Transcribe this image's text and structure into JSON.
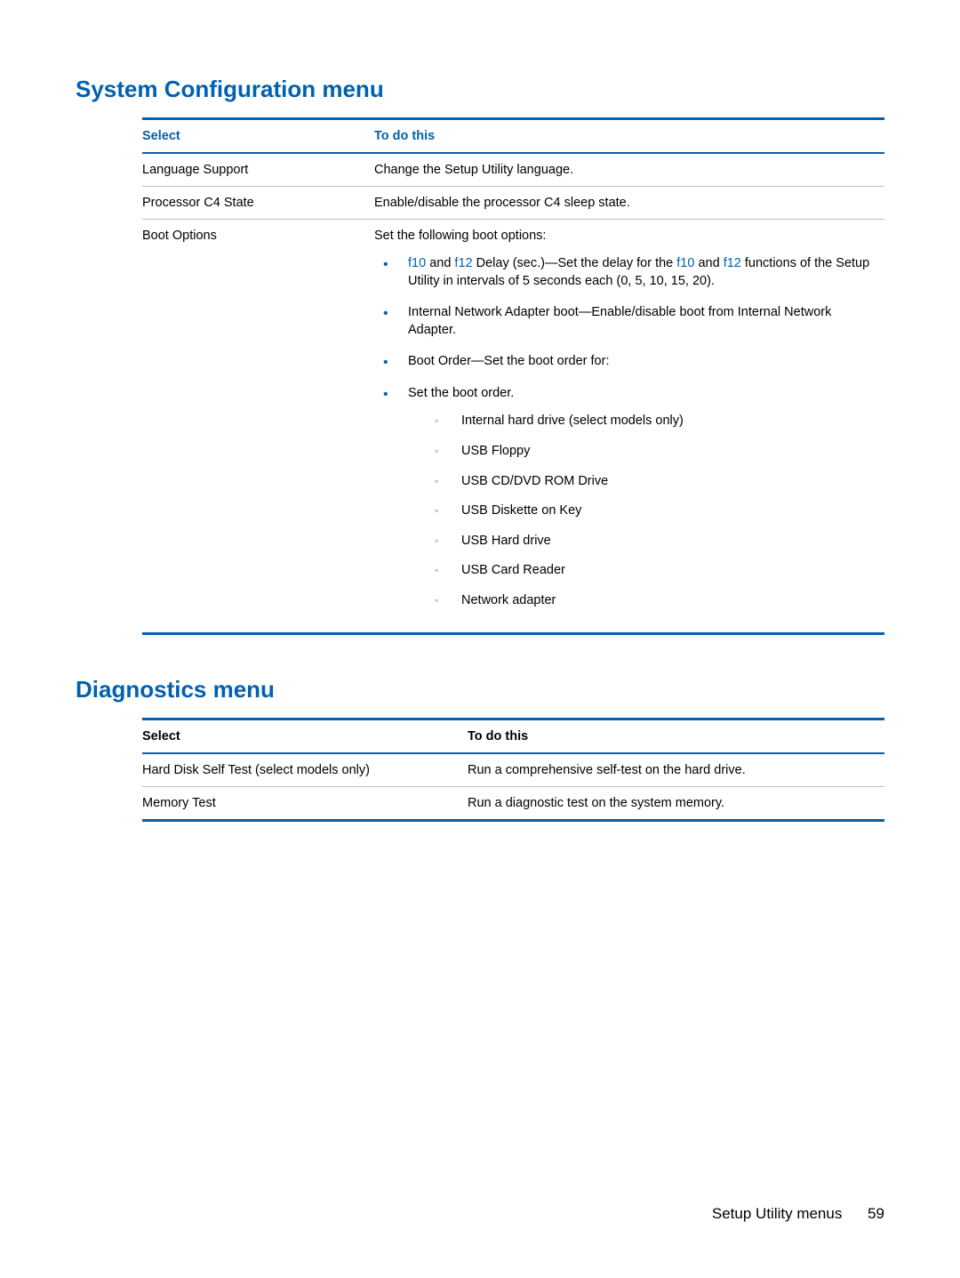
{
  "section1": {
    "title": "System Configuration menu",
    "headers": {
      "col1": "Select",
      "col2": "To do this"
    },
    "rows": [
      {
        "select": "Language Support",
        "desc": "Change the Setup Utility language."
      },
      {
        "select": "Processor C4 State",
        "desc": "Enable/disable the processor C4 sleep state."
      }
    ],
    "bootOptions": {
      "select": "Boot Options",
      "intro": "Set the following boot options:",
      "bullets": {
        "b1_pre": "",
        "b1_f10": "f10",
        "b1_mid1": " and ",
        "b1_f12": "f12",
        "b1_mid2": " Delay (sec.)—Set the delay for the ",
        "b1_f10b": "f10",
        "b1_mid3": " and ",
        "b1_f12b": "f12",
        "b1_post": " functions of the Setup Utility in intervals of 5 seconds each (0, 5, 10, 15, 20).",
        "b2": "Internal Network Adapter boot—Enable/disable boot from Internal Network Adapter.",
        "b3": "Boot Order—Set the boot order for:",
        "b4": "Set the boot order."
      },
      "sub": [
        "Internal hard drive (select models only)",
        "USB Floppy",
        "USB CD/DVD ROM Drive",
        "USB Diskette on Key",
        "USB Hard drive",
        "USB Card Reader",
        "Network adapter"
      ]
    }
  },
  "section2": {
    "title": "Diagnostics menu",
    "headers": {
      "col1": "Select",
      "col2": "To do this"
    },
    "rows": [
      {
        "select": "Hard Disk Self Test (select models only)",
        "desc": "Run a comprehensive self-test on the hard drive."
      },
      {
        "select": "Memory Test",
        "desc": "Run a diagnostic test on the system memory."
      }
    ]
  },
  "footer": {
    "label": "Setup Utility menus",
    "page": "59"
  }
}
